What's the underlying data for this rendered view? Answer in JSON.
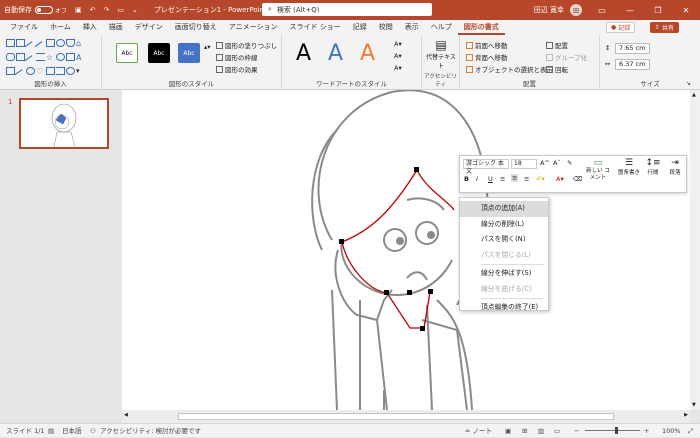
{
  "titlebar": {
    "autosave_label": "自動保存",
    "autosave_state": "オフ",
    "document_title": "プレゼンテーション1 - PowerPoint",
    "search_placeholder": "検索 (Alt+Q)",
    "user_name": "田辺 寛幸",
    "user_initials": "田"
  },
  "tabs": {
    "items": [
      "ファイル",
      "ホーム",
      "挿入",
      "描画",
      "デザイン",
      "画面切り替え",
      "アニメーション",
      "スライド ショー",
      "記録",
      "校閲",
      "表示",
      "ヘルプ",
      "図形の書式"
    ],
    "active": "図形の書式",
    "record_label": "記録",
    "share_label": "共有"
  },
  "ribbon": {
    "insert_shapes_label": "図形の挿入",
    "shape_styles_label": "図形のスタイル",
    "style_sample_label": "Abc",
    "shape_fill_label": "図形の塗りつぶし",
    "shape_outline_label": "図形の枠線",
    "shape_effects_label": "図形の効果",
    "wordart_sample": "A",
    "wordart_styles_label": "ワードアートのスタイル",
    "alt_text_label": "代替テキスト",
    "accessibility_label": "アクセシビリティ",
    "bring_forward_label": "前面へ移動",
    "send_backward_label": "背面へ移動",
    "selection_pane_label": "オブジェクトの選択と表示",
    "align_label": "配置",
    "group_label": "グループ化",
    "rotate_label": "回転",
    "arrange_label": "配置",
    "height_value": "7.65 cm",
    "width_value": "6.37 cm",
    "size_label": "サイズ"
  },
  "slides": {
    "current_number": "1"
  },
  "mini_toolbar": {
    "font_name": "游ゴシック 本文",
    "font_size": "18",
    "bold": "B",
    "italic": "I",
    "underline": "U",
    "new_comment_label": "新しい コメント",
    "bullets_label": "箇条書き",
    "line_spacing_label": "行間",
    "paragraph_label": "段落"
  },
  "context_menu": {
    "items": [
      {
        "label": "頂点の追加(A)",
        "state": "hover"
      },
      {
        "label": "線分の削除(L)",
        "state": "normal"
      },
      {
        "label": "パスを開く(N)",
        "state": "normal"
      },
      {
        "label": "パスを閉じる(L)",
        "state": "disabled"
      },
      {
        "label": "線分を伸ばす(S)",
        "state": "normal"
      },
      {
        "label": "線分を曲げる(C)",
        "state": "disabled"
      },
      {
        "label": "頂点編集の終了(E)",
        "state": "normal"
      }
    ]
  },
  "statusbar": {
    "slide_info": "スライド 1/1",
    "language": "日本語",
    "accessibility": "アクセシビリティ: 検討が必要です",
    "notes_label": "ノート",
    "zoom_level": "100%"
  },
  "colors": {
    "accent": "#b7472a",
    "style_fill_dark": "#000000",
    "style_fill_blue": "#4472c4",
    "wordart_blue": "#4472c4",
    "wordart_orange": "#ed7d31",
    "edit_path": "#c00000"
  }
}
